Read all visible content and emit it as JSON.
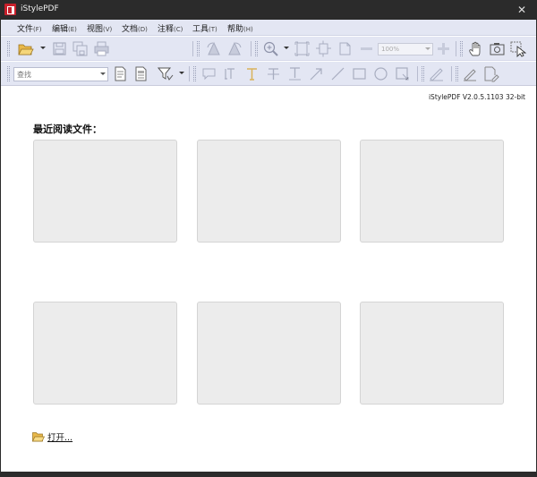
{
  "window": {
    "title": "iStylePDF",
    "close_glyph": "✕"
  },
  "menu": [
    {
      "label": "文件",
      "accel": "(F)"
    },
    {
      "label": "编辑",
      "accel": "(E)"
    },
    {
      "label": "视图",
      "accel": "(V)"
    },
    {
      "label": "文档",
      "accel": "(D)"
    },
    {
      "label": "注释",
      "accel": "(C)"
    },
    {
      "label": "工具",
      "accel": "(T)"
    },
    {
      "label": "帮助",
      "accel": "(H)"
    }
  ],
  "toolbar1": {
    "icons": [
      "open-folder-icon",
      "save-icon",
      "save-all-icon",
      "print-icon",
      "rotate-left-icon",
      "rotate-right-icon",
      "zoom-icon",
      "fit-page-icon",
      "fit-width-icon",
      "actual-size-icon",
      "zoom-out-icon",
      "zoom-in-icon",
      "hand-tool-icon",
      "snapshot-icon",
      "select-tool-icon"
    ],
    "zoom_value": "100%"
  },
  "toolbar2": {
    "search_placeholder": "查找",
    "icons": [
      "document-properties-icon",
      "document-summary-icon",
      "filter-icon",
      "comment-icon",
      "text-box-icon",
      "highlight-text-icon",
      "strikeout-icon",
      "underline-icon",
      "arrow-icon",
      "line-icon",
      "rectangle-icon",
      "ellipse-icon",
      "stamp-icon",
      "sign-icon",
      "pencil-icon",
      "edit-document-icon"
    ]
  },
  "start_page": {
    "version": "iStylePDF V2.0.5.1103 32-bit",
    "recent_title": "最近阅读文件：",
    "recent_files": [
      "",
      "",
      "",
      "",
      "",
      ""
    ],
    "open_label": "打开..."
  },
  "colors": {
    "toolbar_bg": "#e3e6f3",
    "title_bg": "#2b2b2b",
    "brand_red": "#c8202b",
    "thumb_bg": "#ececec"
  }
}
